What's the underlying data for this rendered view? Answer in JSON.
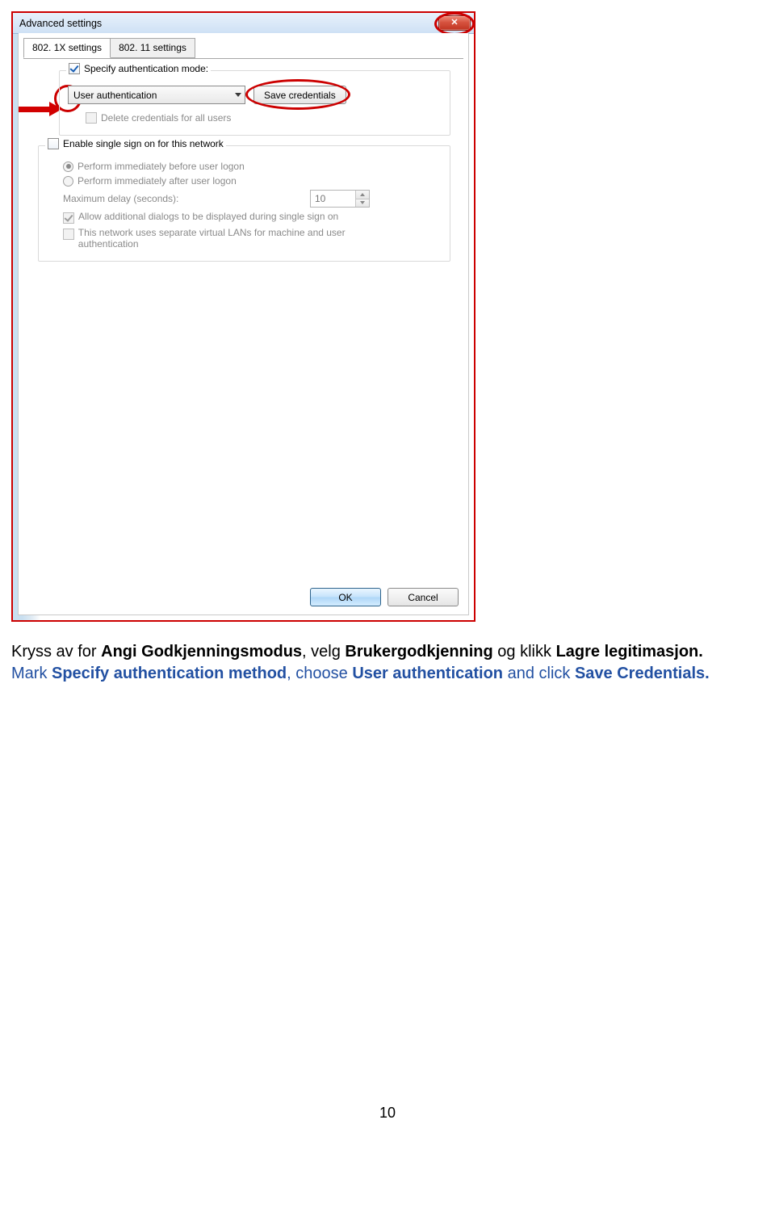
{
  "dialog": {
    "title": "Advanced settings",
    "tabs": {
      "active": "802. 1X settings",
      "inactive": "802. 11 settings"
    },
    "auth": {
      "specify_label": "Specify authentication mode:",
      "dropdown_value": "User authentication",
      "save_btn": "Save credentials",
      "delete_label": "Delete credentials for all users"
    },
    "sso": {
      "enable_label": "Enable single sign on for this network",
      "before": "Perform immediately before user logon",
      "after": "Perform immediately after user logon",
      "maxdelay_label": "Maximum delay (seconds):",
      "maxdelay_value": "10",
      "allow_dialogs": "Allow additional dialogs to be displayed during single sign on",
      "vlan": "This network uses separate virtual LANs for machine and user authentication"
    },
    "ok": "OK",
    "cancel": "Cancel"
  },
  "caption": {
    "no_1": "Kryss av for ",
    "no_bold1": "Angi Godkjenningsmodus",
    "no_2": ", velg ",
    "no_bold2": "Brukergodkjenning",
    "no_3": " og klikk ",
    "no_bold3": "Lagre legitimasjon.",
    "en_1": "Mark ",
    "en_bold1": "Specify authentication method",
    "en_2": ", choose ",
    "en_bold2": "User authentication",
    "en_3": " and click ",
    "en_bold3": "Save Credentials."
  },
  "page_number": "10"
}
